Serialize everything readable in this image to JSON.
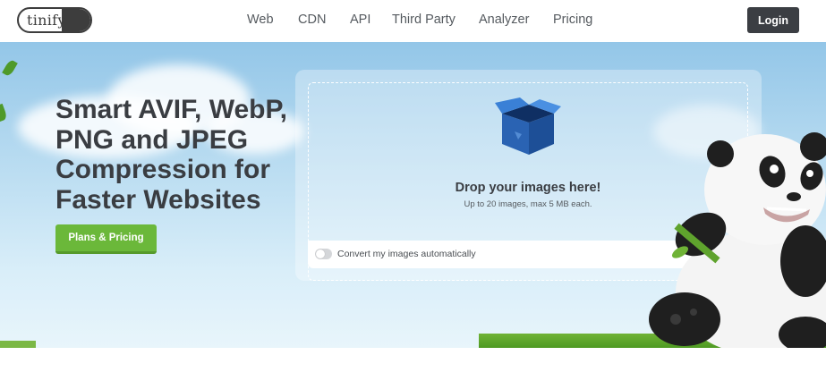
{
  "header": {
    "logo_text": "tinify",
    "nav": [
      {
        "label": "Web"
      },
      {
        "label": "CDN"
      },
      {
        "label": "API"
      },
      {
        "label": "Third Party"
      },
      {
        "label": "Analyzer"
      },
      {
        "label": "Pricing"
      }
    ],
    "login_label": "Login"
  },
  "hero": {
    "headline_lines": [
      "Smart AVIF, WebP,",
      "PNG and JPEG",
      "Compression for",
      "Faster Websites"
    ],
    "cta_label": "Plans & Pricing"
  },
  "upload": {
    "title": "Drop your images here!",
    "subtitle": "Up to 20 images, max 5 MB each.",
    "convert_label": "Convert my images automatically",
    "convert_enabled": false
  },
  "colors": {
    "accent_green": "#6bb83a",
    "dark_button": "#3b3e43",
    "box_blue": "#2f6fc4"
  }
}
